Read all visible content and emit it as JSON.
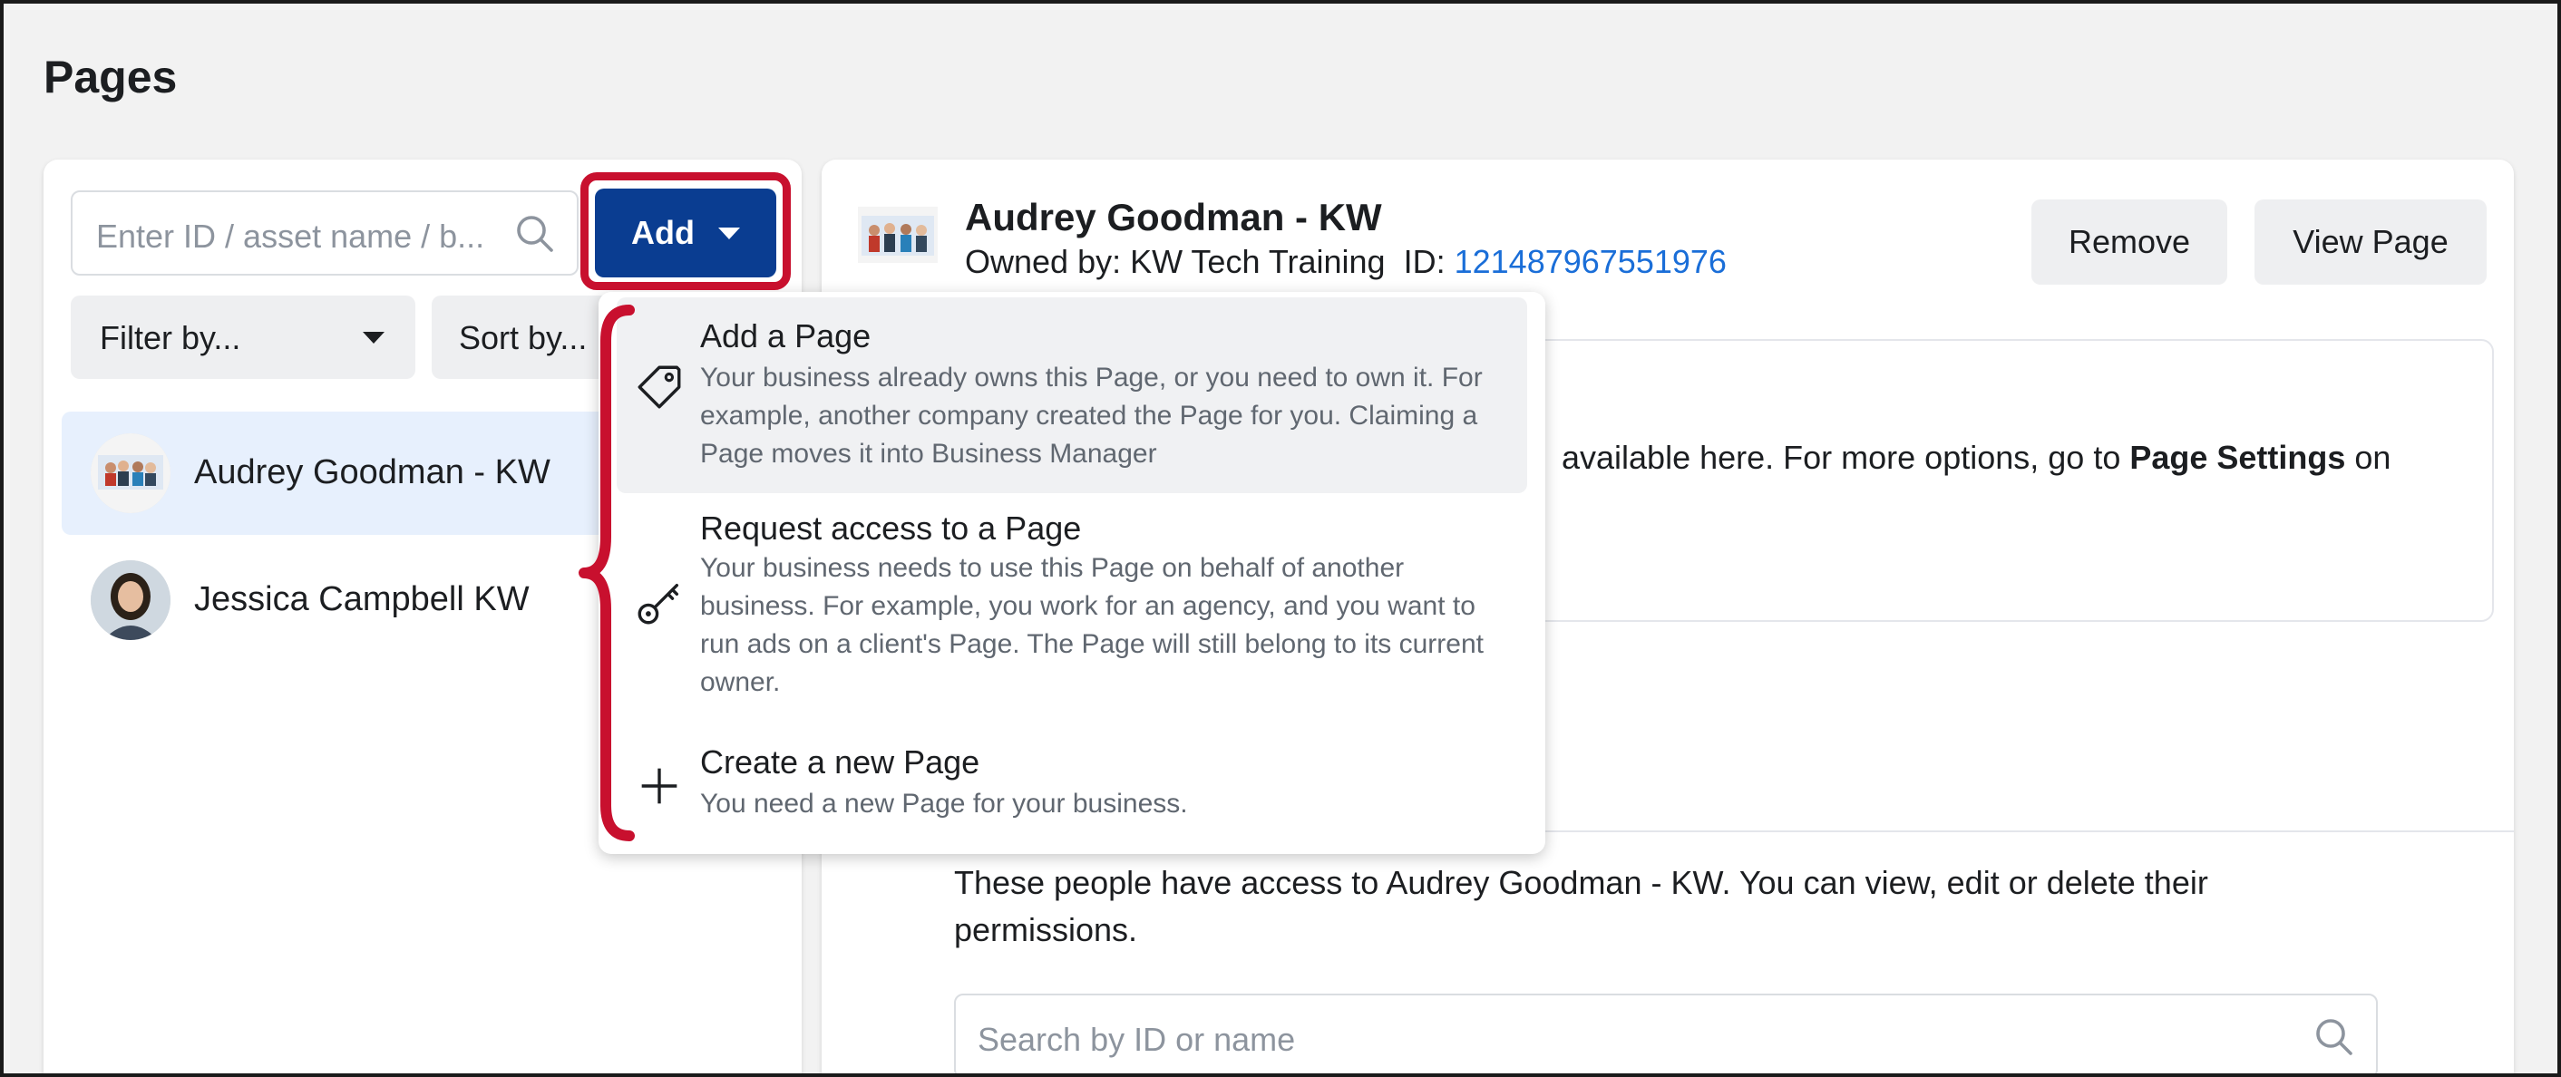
{
  "page": {
    "title": "Pages"
  },
  "left_panel": {
    "search_placeholder": "Enter ID / asset name / b...",
    "add_button_label": "Add",
    "filter_label": "Filter by...",
    "sort_label": "Sort by...",
    "pages": [
      {
        "name": "Audrey Goodman - KW",
        "selected": true
      },
      {
        "name": "Jessica Campbell KW",
        "selected": false
      }
    ]
  },
  "detail": {
    "name": "Audrey Goodman - KW",
    "owned_by": "Owned by: KW Tech Training",
    "id_label": "ID:",
    "id_value": "121487967551976",
    "remove_label": "Remove",
    "view_page_label": "View Page",
    "info_text_plain": "available here. For more options, go to ",
    "info_text_bold": "Page Settings",
    "info_text_end": " on",
    "people_text": "These people have access to Audrey Goodman - KW. You can view, edit or delete their permissions.",
    "people_search_placeholder": "Search by ID or name"
  },
  "add_menu": {
    "items": [
      {
        "title": "Add a Page",
        "description": "Your business already owns this Page, or you need to own it. For example, another company created the Page for you. Claiming a Page moves it into Business Manager",
        "icon": "tag-icon"
      },
      {
        "title": "Request access to a Page",
        "description": "Your business needs to use this Page on behalf of another business. For example, you work for an agency, and you want to run ads on a client's Page. The Page will still belong to its current owner.",
        "icon": "key-icon"
      },
      {
        "title": "Create a new Page",
        "description": "You need a new Page for your business.",
        "icon": "plus-icon"
      }
    ]
  },
  "colors": {
    "primary": "#0a3d91",
    "highlight": "#c8102e",
    "link": "#1a6ed8",
    "selected_row": "#e7f0fd"
  }
}
